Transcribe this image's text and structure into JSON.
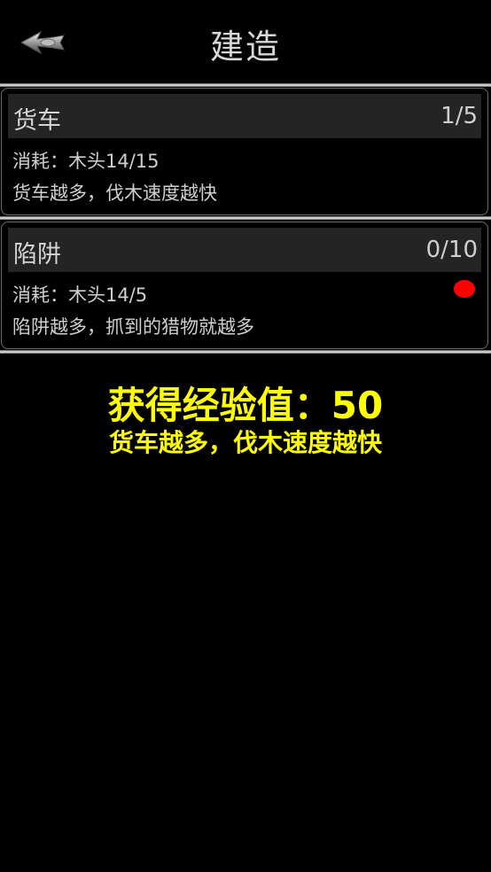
{
  "header": {
    "title": "建造",
    "back_icon": "back-arrow-icon"
  },
  "buildings": [
    {
      "name": "货车",
      "count": "1/5",
      "cost": "消耗：木头14/15",
      "desc": "货车越多，伐木速度越快"
    },
    {
      "name": "陷阱",
      "count": "0/10",
      "cost": "消耗：木头14/5",
      "desc": "陷阱越多，抓到的猎物就越多",
      "indicator_color": "#ff0000"
    }
  ],
  "reward": {
    "xp_text": "获得经验值：50",
    "tip_text": "货车越多，伐木速度越快"
  },
  "colors": {
    "background": "#000000",
    "highlight": "#ffff00",
    "card_header": "#242424"
  }
}
